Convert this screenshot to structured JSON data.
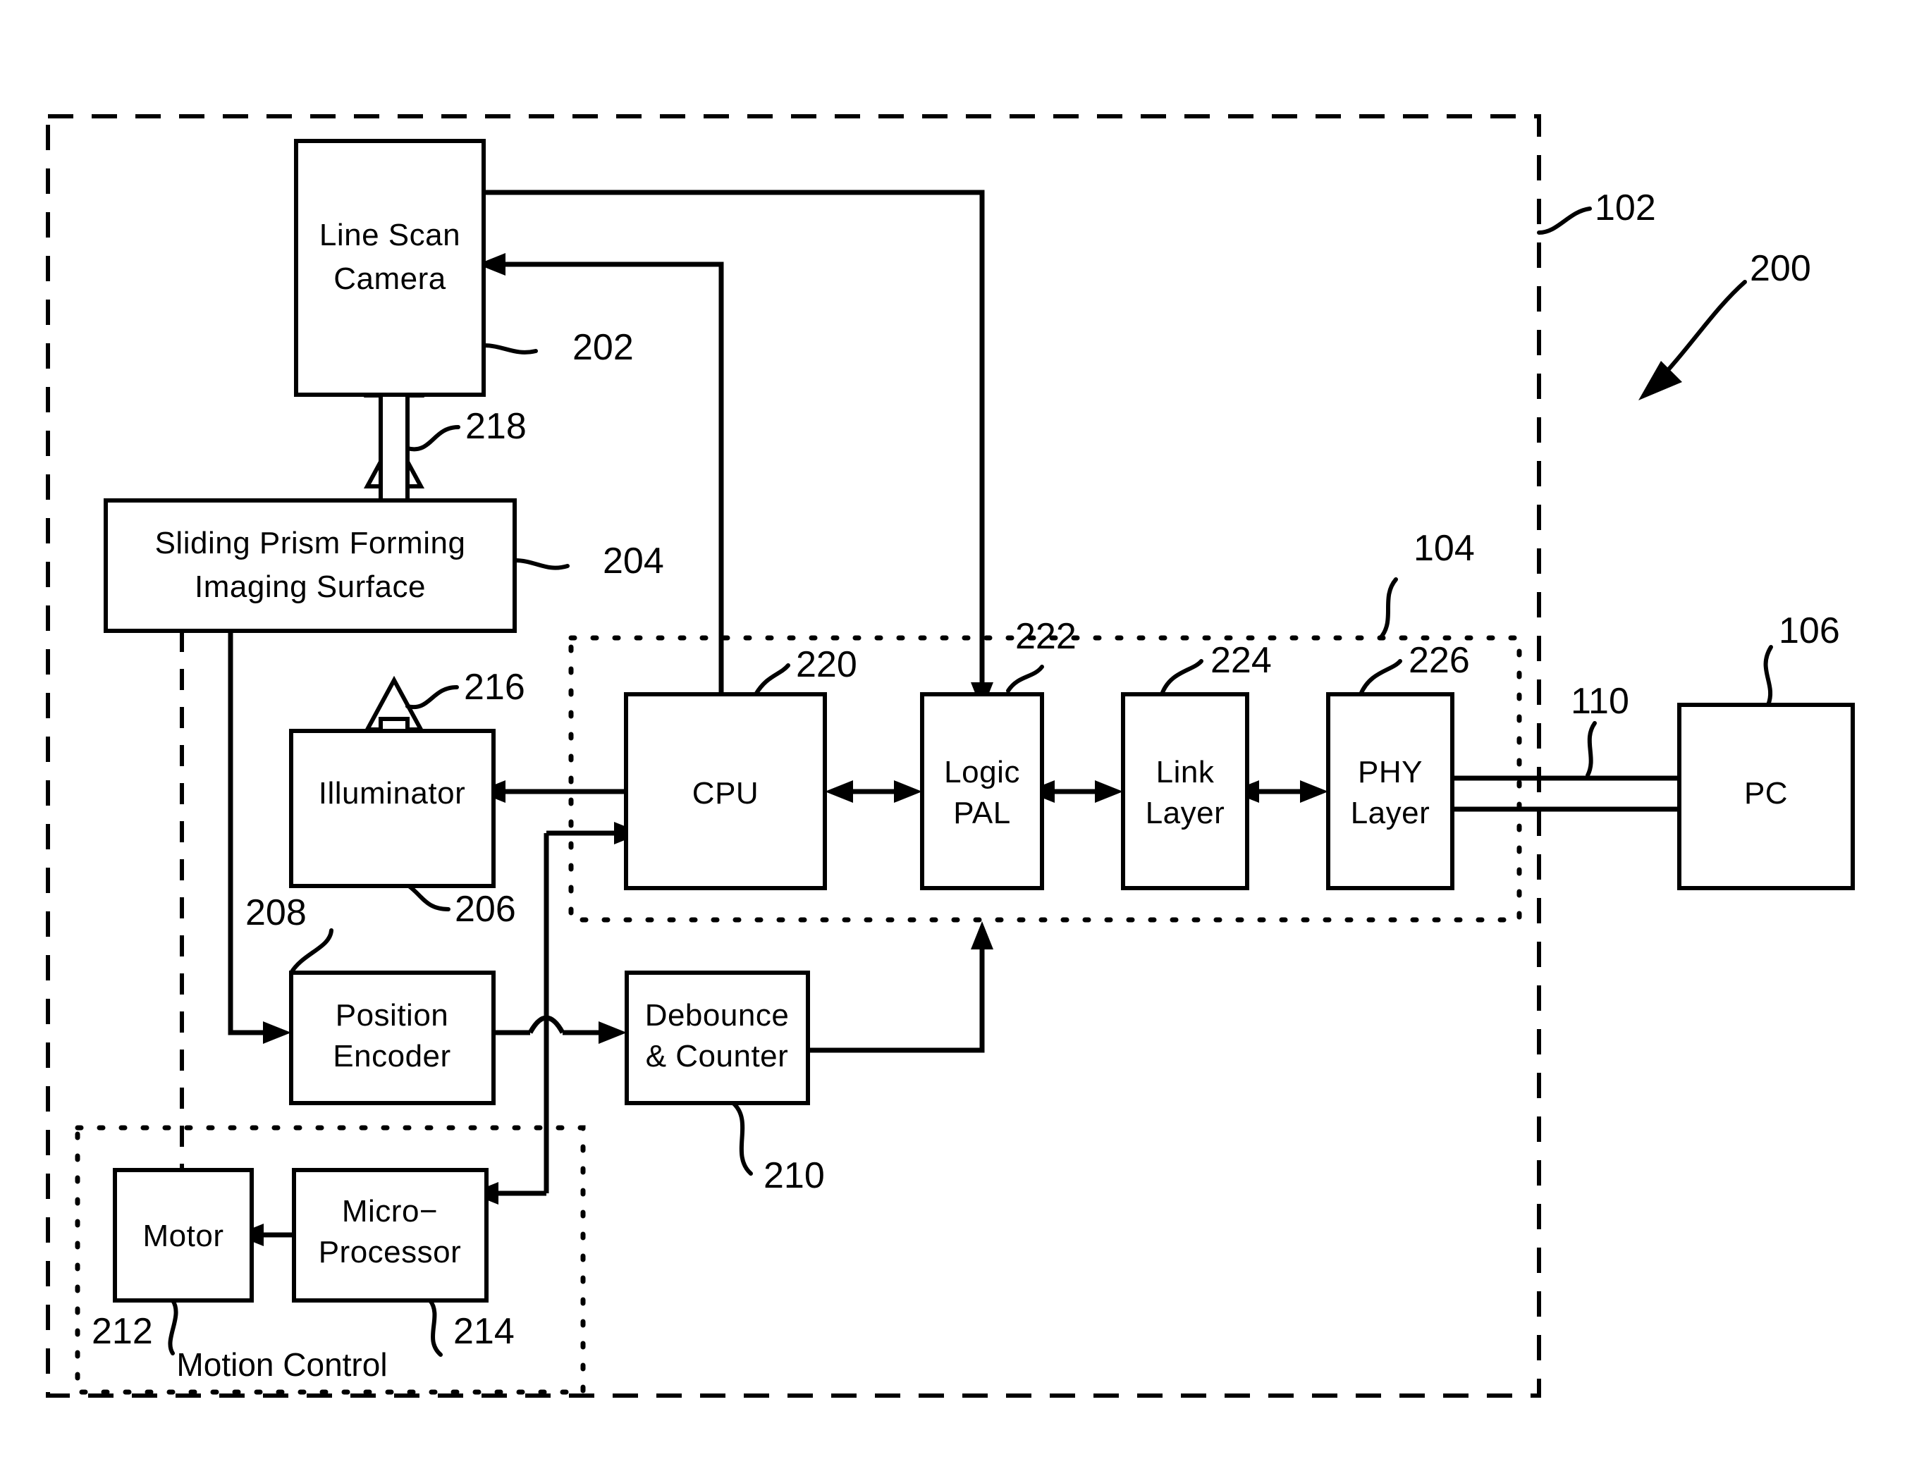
{
  "figure": {
    "blocks": {
      "line_scan_camera": "Line Scan\nCamera",
      "line_scan_camera_l1": "Line Scan",
      "line_scan_camera_l2": "Camera",
      "sliding_prism_l1": "Sliding  Prism  Forming",
      "sliding_prism_l2": "Imaging  Surface",
      "illuminator": "Illuminator",
      "position_encoder_l1": "Position",
      "position_encoder_l2": "Encoder",
      "debounce_l1": "Debounce",
      "debounce_l2": "& Counter",
      "cpu": "CPU",
      "logic_pal_l1": "Logic",
      "logic_pal_l2": "PAL",
      "link_layer_l1": "Link",
      "link_layer_l2": "Layer",
      "phy_layer_l1": "PHY",
      "phy_layer_l2": "Layer",
      "pc": "PC",
      "motor": "Motor",
      "microprocessor_l1": "Micro−",
      "microprocessor_l2": "Processor"
    },
    "group_labels": {
      "motion_control": "Motion Control"
    },
    "reference_numerals": {
      "scanner_enclosure": "102",
      "interface_group": "104",
      "host": "106",
      "cable": "110",
      "figure_number": "200",
      "camera": "202",
      "prism": "204",
      "illuminator": "206",
      "position_encoder": "208",
      "debounce_counter": "210",
      "motor": "212",
      "microprocessor": "214",
      "light_path_lower": "216",
      "light_path_upper": "218",
      "cpu": "220",
      "logic_pal": "222",
      "link_layer": "224",
      "phy_layer": "226"
    }
  }
}
